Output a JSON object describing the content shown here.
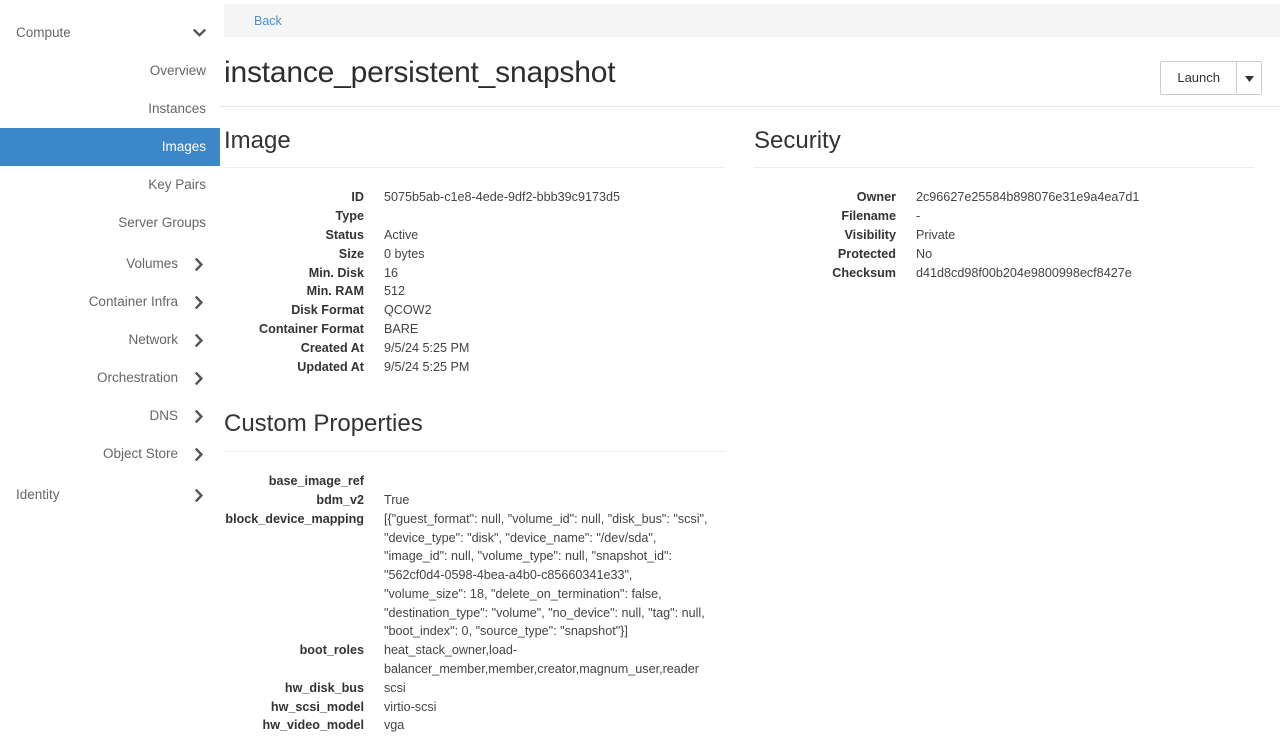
{
  "sidebar": {
    "items": [
      {
        "label": "Compute",
        "icon": "chevron-down-icon",
        "level": "top",
        "expanded": true,
        "active": false,
        "name": "sidebar-item-compute"
      },
      {
        "label": "Overview",
        "icon": "",
        "level": "child",
        "expanded": false,
        "active": false,
        "name": "sidebar-item-overview"
      },
      {
        "label": "Instances",
        "icon": "",
        "level": "child",
        "expanded": false,
        "active": false,
        "name": "sidebar-item-instances"
      },
      {
        "label": "Images",
        "icon": "",
        "level": "child",
        "expanded": false,
        "active": true,
        "name": "sidebar-item-images"
      },
      {
        "label": "Key Pairs",
        "icon": "",
        "level": "child",
        "expanded": false,
        "active": false,
        "name": "sidebar-item-key-pairs"
      },
      {
        "label": "Server Groups",
        "icon": "",
        "level": "child",
        "expanded": false,
        "active": false,
        "name": "sidebar-item-server-groups"
      },
      {
        "label": "Volumes",
        "icon": "chevron-right-icon",
        "level": "group",
        "expanded": false,
        "active": false,
        "name": "sidebar-item-volumes"
      },
      {
        "label": "Container Infra",
        "icon": "chevron-right-icon",
        "level": "group",
        "expanded": false,
        "active": false,
        "name": "sidebar-item-container-infra"
      },
      {
        "label": "Network",
        "icon": "chevron-right-icon",
        "level": "group",
        "expanded": false,
        "active": false,
        "name": "sidebar-item-network"
      },
      {
        "label": "Orchestration",
        "icon": "chevron-right-icon",
        "level": "group",
        "expanded": false,
        "active": false,
        "name": "sidebar-item-orchestration"
      },
      {
        "label": "DNS",
        "icon": "chevron-right-icon",
        "level": "group",
        "expanded": false,
        "active": false,
        "name": "sidebar-item-dns"
      },
      {
        "label": "Object Store",
        "icon": "chevron-right-icon",
        "level": "group",
        "expanded": false,
        "active": false,
        "name": "sidebar-item-object-store"
      },
      {
        "label": "Identity",
        "icon": "chevron-right-icon",
        "level": "top",
        "expanded": false,
        "active": false,
        "name": "sidebar-item-identity"
      }
    ],
    "active_color": "#3c87c8",
    "active_text_color": "#ffffff",
    "text_color": "#666666"
  },
  "breadcrumb": {
    "back_label": "Back",
    "link_color": "#4d90cd",
    "background": "#f5f5f5"
  },
  "header": {
    "title": "instance_persistent_snapshot",
    "launch_label": "Launch",
    "caret_icon": "caret-down-icon"
  },
  "image_section": {
    "title": "Image",
    "rows": [
      {
        "label": "ID",
        "value": "5075b5ab-c1e8-4ede-9df2-bbb39c9173d5"
      },
      {
        "label": "Type",
        "value": ""
      },
      {
        "label": "Status",
        "value": "Active"
      },
      {
        "label": "Size",
        "value": "0 bytes"
      },
      {
        "label": "Min. Disk",
        "value": "16"
      },
      {
        "label": "Min. RAM",
        "value": "512"
      },
      {
        "label": "Disk Format",
        "value": "QCOW2"
      },
      {
        "label": "Container Format",
        "value": "BARE"
      },
      {
        "label": "Created At",
        "value": "9/5/24 5:25 PM"
      },
      {
        "label": "Updated At",
        "value": "9/5/24 5:25 PM"
      }
    ]
  },
  "security_section": {
    "title": "Security",
    "rows": [
      {
        "label": "Owner",
        "value": "2c96627e25584b898076e31e9a4ea7d1"
      },
      {
        "label": "Filename",
        "value": "-"
      },
      {
        "label": "Visibility",
        "value": "Private"
      },
      {
        "label": "Protected",
        "value": "No"
      },
      {
        "label": "Checksum",
        "value": "d41d8cd98f00b204e9800998ecf8427e"
      }
    ]
  },
  "custom_properties_section": {
    "title": "Custom Properties",
    "rows": [
      {
        "label": "base_image_ref",
        "value": ""
      },
      {
        "label": "bdm_v2",
        "value": "True"
      },
      {
        "label": "block_device_mapping",
        "value": "[{\"guest_format\": null, \"volume_id\": null, \"disk_bus\": \"scsi\", \"device_type\": \"disk\", \"device_name\": \"/dev/sda\", \"image_id\": null, \"volume_type\": null, \"snapshot_id\": \"562cf0d4-0598-4bea-a4b0-c85660341e33\", \"volume_size\": 18, \"delete_on_termination\": false, \"destination_type\": \"volume\", \"no_device\": null, \"tag\": null, \"boot_index\": 0, \"source_type\": \"snapshot\"}]"
      },
      {
        "label": "boot_roles",
        "value": "heat_stack_owner,load-balancer_member,member,creator,magnum_user,reader"
      },
      {
        "label": "hw_disk_bus",
        "value": "scsi"
      },
      {
        "label": "hw_scsi_model",
        "value": "virtio-scsi"
      },
      {
        "label": "hw_video_model",
        "value": "vga"
      }
    ]
  }
}
